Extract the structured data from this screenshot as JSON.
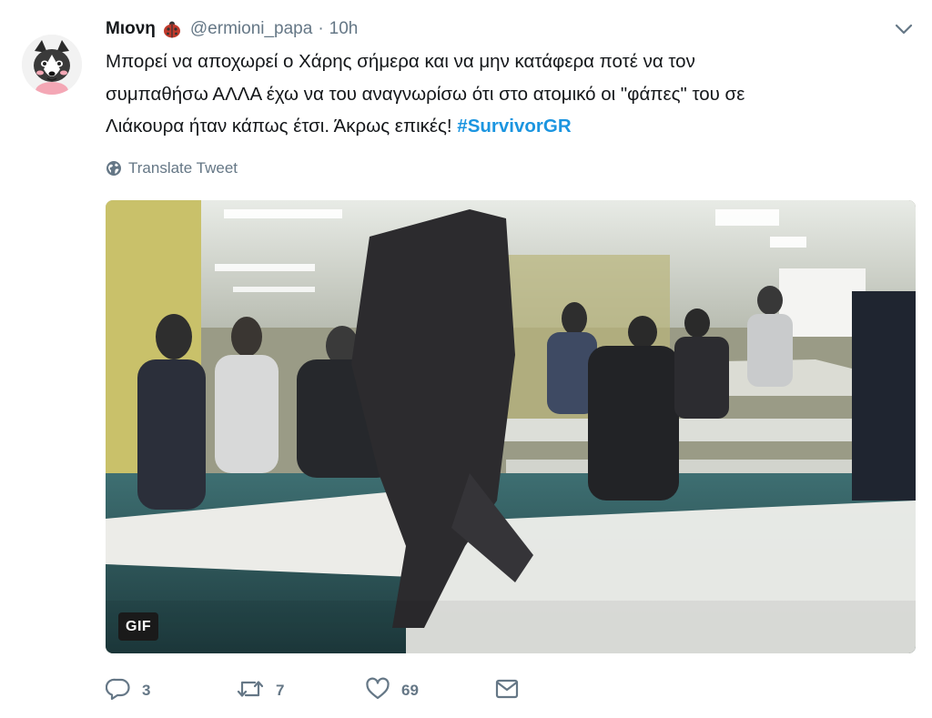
{
  "tweet": {
    "display_name": "Μιονη",
    "handle": "@ermioni_papa",
    "separator": "·",
    "time": "10h",
    "text_lines": [
      "Μπορεί να αποχωρεί ο Χάρης σήμερα και να μην κατάφερα ποτέ να τον",
      "συμπαθήσω ΑΛΛΑ έχω να του αναγνωρίσω ότι στο ατομικό οι \"φάπες\" του σε",
      "Λιάκουρα ήταν κάπως έτσι. Άκρως επικές! "
    ],
    "hashtag": "#SurvivorGR",
    "translate_label": "Translate Tweet",
    "media_badge": "GIF",
    "counts": {
      "replies": "3",
      "retweets": "7",
      "likes": "69"
    }
  },
  "icons": {
    "badge": "ladybug-icon",
    "caret": "chevron-down-icon",
    "translate": "globe-icon",
    "reply": "reply-icon",
    "retweet": "retweet-icon",
    "like": "heart-icon",
    "dm": "envelope-icon"
  },
  "colors": {
    "text": "#14171a",
    "secondary": "#657786",
    "hashtag": "#1b95e0",
    "badge_red": "#c0392b"
  }
}
